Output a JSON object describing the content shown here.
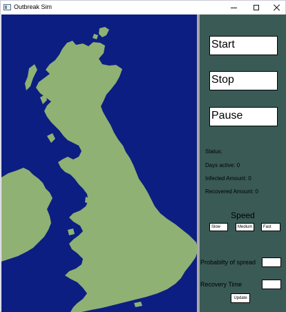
{
  "window": {
    "title": "Outbreak Sim"
  },
  "colors": {
    "sea": "#0c1e82",
    "land": "#8fb173",
    "panel": "#3a5a55"
  },
  "controls": {
    "start_label": "Start",
    "stop_label": "Stop",
    "pause_label": "Pause"
  },
  "status": {
    "label": "Status:",
    "days_active": "Days active: 0",
    "infected_amount": "Infected Amount: 0",
    "recovered_amount": "Recovered Amount: 0"
  },
  "speed": {
    "title": "Speed",
    "options": [
      "Slow",
      "Medium",
      "Fast"
    ]
  },
  "settings": {
    "probability_label": "Probabilty of spread",
    "probability_value": "",
    "recovery_label": "Recovery Time",
    "recovery_value": "",
    "update_label": "Update"
  }
}
